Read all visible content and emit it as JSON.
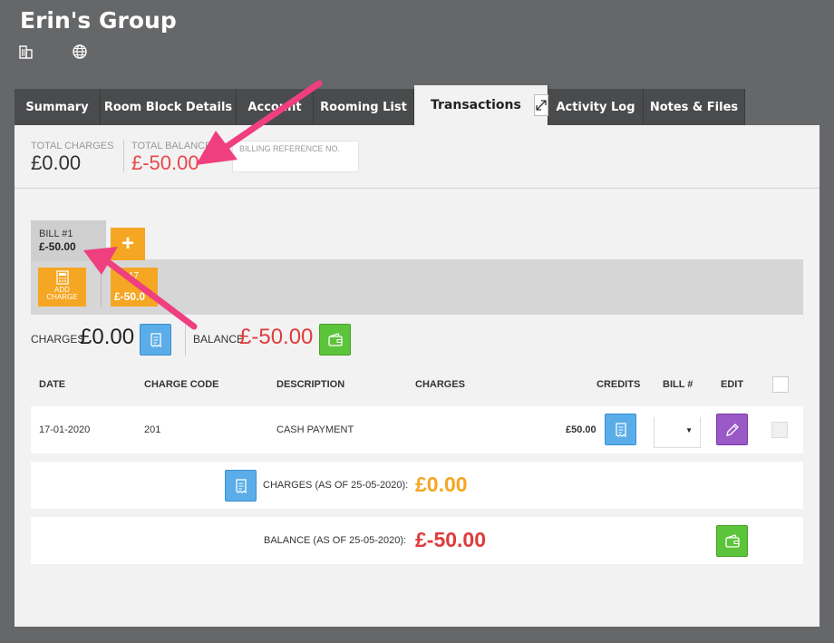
{
  "header": {
    "title": "Erin's Group",
    "icons": [
      "building-icon",
      "globe-icon"
    ]
  },
  "tabs": [
    {
      "label": "Summary"
    },
    {
      "label": "Room Block Details"
    },
    {
      "label": "Account"
    },
    {
      "label": "Rooming List"
    },
    {
      "label": "Transactions",
      "active": true
    },
    {
      "label": "Activity Log"
    },
    {
      "label": "Notes & Files"
    }
  ],
  "totals": {
    "total_charges_label": "TOTAL CHARGES",
    "total_charges_value": "£0.00",
    "total_balance_label": "TOTAL BALANCE",
    "total_balance_value": "£-50.00",
    "billing_ref_label": "BILLING REFERENCE NO."
  },
  "bill": {
    "label": "BILL #1",
    "amount": "£-50.00",
    "plus": "+",
    "add_charge_line1": "ADD",
    "add_charge_line2": "CHARGE",
    "chip_line1": "17",
    "chip_line2": "£-50.0"
  },
  "summary": {
    "charges_label": "CHARGES",
    "charges_value": "£0.00",
    "balance_label": "BALANCE",
    "balance_value": "£-50.00"
  },
  "table": {
    "headers": [
      "DATE",
      "CHARGE CODE",
      "DESCRIPTION",
      "CHARGES",
      "CREDITS",
      "BILL #",
      "EDIT"
    ],
    "rows": [
      {
        "date": "17-01-2020",
        "code": "201",
        "description": "CASH PAYMENT",
        "charges": "",
        "credits": "£50.00",
        "bill": ""
      }
    ]
  },
  "footer": {
    "charges_label": "CHARGES (AS OF 25-05-2020):",
    "charges_value": "£0.00",
    "balance_label": "BALANCE (AS OF 25-05-2020):",
    "balance_value": "£-50.00"
  },
  "colors": {
    "accent_orange": "#f5a623",
    "balance_red": "#e03b3b",
    "annotation_pink": "#ef3f7f"
  }
}
